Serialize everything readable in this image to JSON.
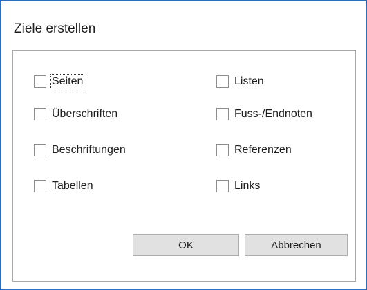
{
  "dialog": {
    "title": "Ziele erstellen",
    "options": [
      {
        "label": "Seiten",
        "checked": false,
        "focused": true
      },
      {
        "label": "Überschriften",
        "checked": false
      },
      {
        "label": "Beschriftungen",
        "checked": false
      },
      {
        "label": "Tabellen",
        "checked": false
      },
      {
        "label": "Listen",
        "checked": false
      },
      {
        "label": "Fuss-/Endnoten",
        "checked": false
      },
      {
        "label": "Referenzen",
        "checked": false
      },
      {
        "label": "Links",
        "checked": false
      }
    ],
    "ok_label": "OK",
    "cancel_label": "Abbrechen"
  },
  "colors": {
    "border_accent": "#2a6fbf",
    "button_bg": "#e1e1e1"
  }
}
